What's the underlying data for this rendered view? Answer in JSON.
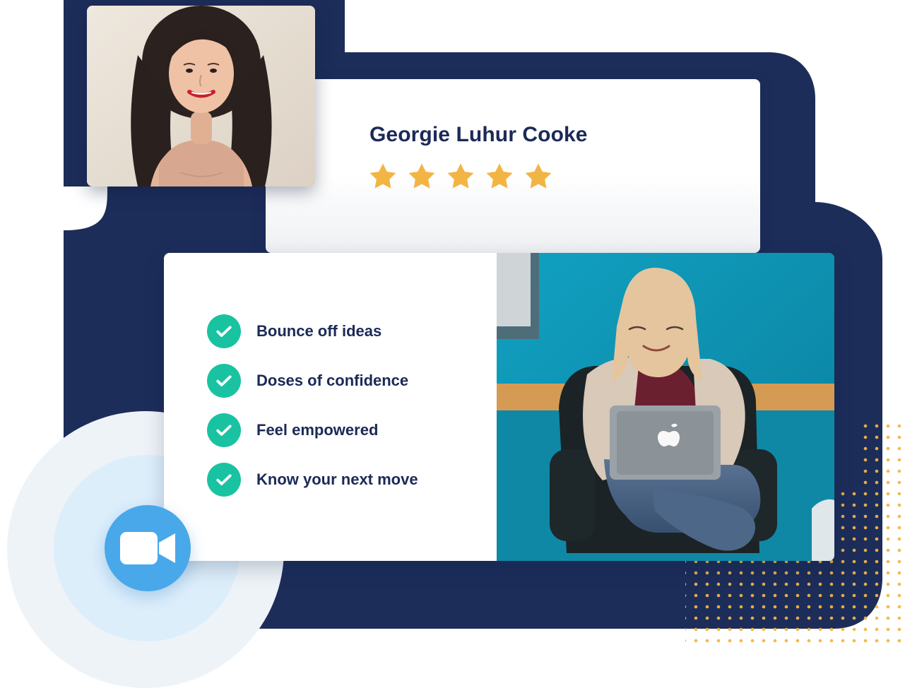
{
  "profile": {
    "name": "Georgie Luhur Cooke",
    "rating": {
      "value": 5,
      "max": 5
    }
  },
  "features": [
    {
      "label": "Bounce off ideas",
      "icon": "check-circle-icon"
    },
    {
      "label": "Doses of confidence",
      "icon": "check-circle-icon"
    },
    {
      "label": "Feel empowered",
      "icon": "check-circle-icon"
    },
    {
      "label": "Know your next move",
      "icon": "check-circle-icon"
    }
  ],
  "call": {
    "icon": "video-camera-icon"
  },
  "colors": {
    "navy": "#1d2d5a",
    "navy_text": "#1b2a57",
    "gold": "#f2b544",
    "teal": "#19c3a1",
    "blue": "#48a8ea",
    "glow_light": "#eef3f8",
    "glow_mid": "#ddeefb"
  }
}
